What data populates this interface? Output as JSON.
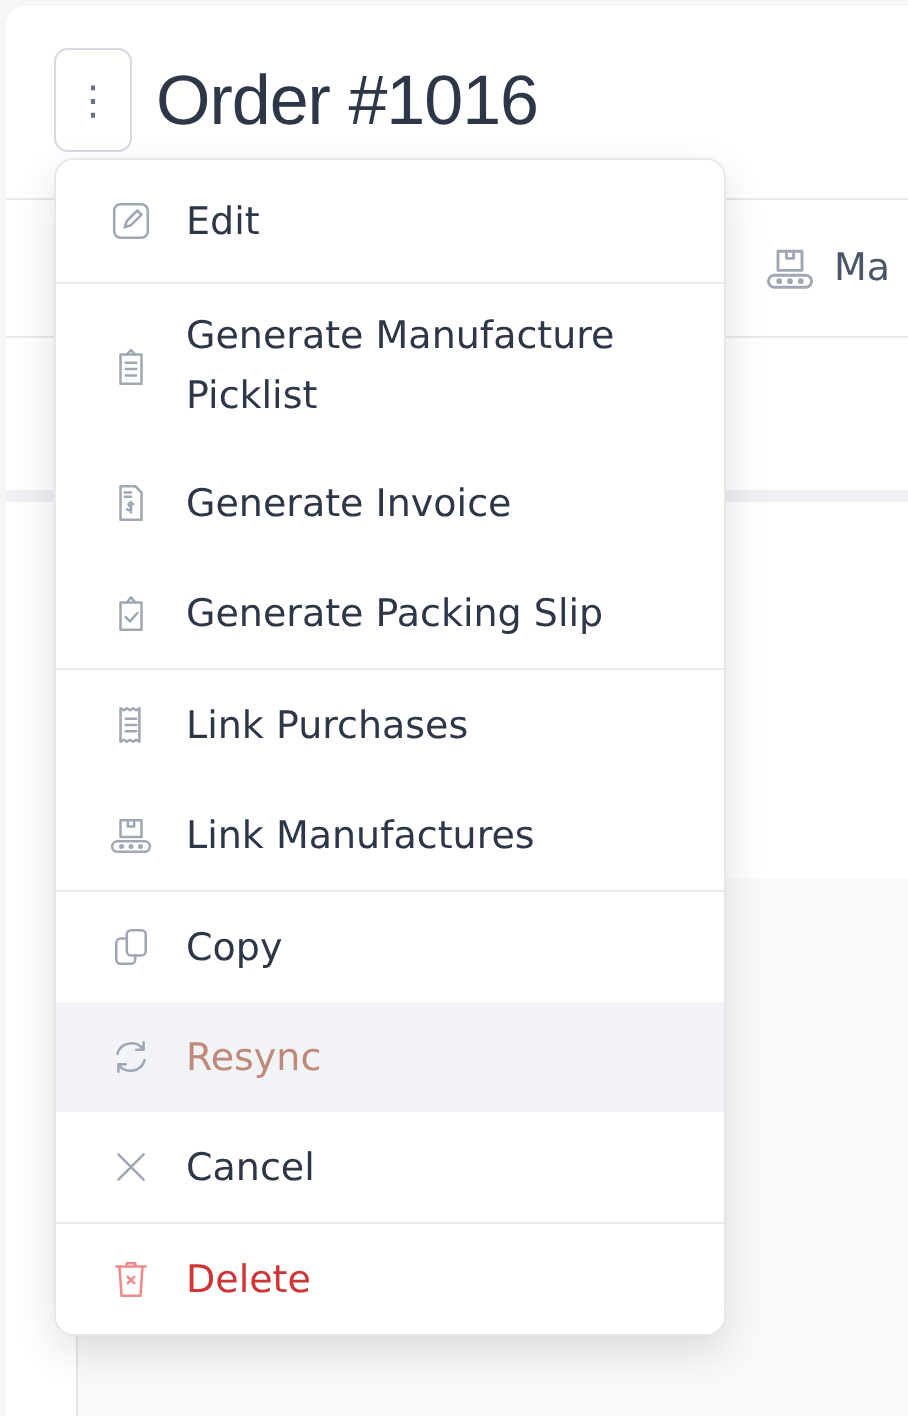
{
  "header": {
    "title": "Order #1016",
    "menu_button": "⋮"
  },
  "tabs": [
    {
      "label": "Ma"
    }
  ],
  "menu": {
    "groups": [
      {
        "items": [
          {
            "label": "Edit",
            "kind": "default",
            "highlighted": false
          }
        ]
      },
      {
        "items": [
          {
            "label": "Generate Manufacture Picklist",
            "kind": "default",
            "highlighted": false
          },
          {
            "label": "Generate Invoice",
            "kind": "default",
            "highlighted": false
          },
          {
            "label": "Generate Packing Slip",
            "kind": "default",
            "highlighted": false
          }
        ]
      },
      {
        "items": [
          {
            "label": "Link Purchases",
            "kind": "default",
            "highlighted": false
          },
          {
            "label": "Link Manufactures",
            "kind": "default",
            "highlighted": false
          }
        ]
      },
      {
        "items": [
          {
            "label": "Copy",
            "kind": "default",
            "highlighted": false
          },
          {
            "label": "Resync",
            "kind": "warning",
            "highlighted": true
          },
          {
            "label": "Cancel",
            "kind": "default",
            "highlighted": false
          }
        ]
      },
      {
        "items": [
          {
            "label": "Delete",
            "kind": "danger",
            "highlighted": false
          }
        ]
      }
    ]
  }
}
